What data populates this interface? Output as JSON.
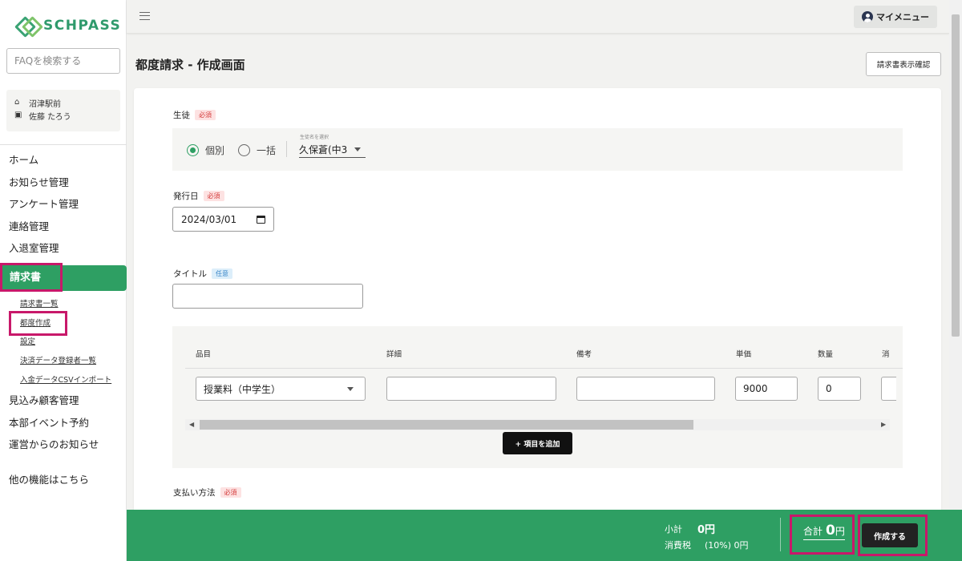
{
  "app": {
    "logo_text": "SCHPASS"
  },
  "sidebar": {
    "faq_placeholder": "FAQを検索する",
    "school": "沼津駅前",
    "user": "佐藤 たろう",
    "items": [
      {
        "label": "ホーム"
      },
      {
        "label": "お知らせ管理"
      },
      {
        "label": "アンケート管理"
      },
      {
        "label": "連絡管理"
      },
      {
        "label": "入退室管理"
      }
    ],
    "active": {
      "label": "請求書"
    },
    "subitems": [
      {
        "label": "請求書一覧"
      },
      {
        "label": "都度作成"
      },
      {
        "label": "設定"
      },
      {
        "label": "決済データ登録者一覧"
      },
      {
        "label": "入金データCSVインポート"
      }
    ],
    "items2": [
      {
        "label": "見込み顧客管理"
      },
      {
        "label": "本部イベント予約"
      },
      {
        "label": "運営からのお知らせ"
      }
    ],
    "other": "他の機能はこちら"
  },
  "header": {
    "my_menu": "マイメニュー"
  },
  "page": {
    "title": "都度請求 - 作成画面",
    "preview_button": "請求書表示確認"
  },
  "form": {
    "student": {
      "label": "生徒",
      "badge": "必須",
      "radio_individual": "個別",
      "radio_bulk": "一括",
      "select_caption": "生徒名を選択",
      "select_value": "久保蒼(中3"
    },
    "issue_date": {
      "label": "発行日",
      "badge": "必須",
      "value": "2024/03/01"
    },
    "title": {
      "label": "タイトル",
      "badge": "任意",
      "value": ""
    },
    "items_table": {
      "headers": [
        "品目",
        "詳細",
        "備考",
        "単価",
        "数量",
        "消"
      ],
      "row": {
        "item": "授業料（中学生）",
        "detail": "",
        "note": "",
        "unit_price": "9000",
        "quantity": "0"
      },
      "add_button": "+ 項目を追加"
    },
    "payment": {
      "label": "支払い方法",
      "badge": "必須"
    }
  },
  "footer": {
    "subtotal_label": "小計",
    "subtotal_value": "0円",
    "tax_label": "消費税",
    "tax_value": "(10%) 0円",
    "total_label": "合計",
    "total_value": "0",
    "total_unit": "円",
    "create_button": "作成する"
  },
  "colors": {
    "brand_green": "#2e9f63",
    "highlight": "#c8186a",
    "required": "#d43b3b",
    "optional": "#3a86c8"
  }
}
